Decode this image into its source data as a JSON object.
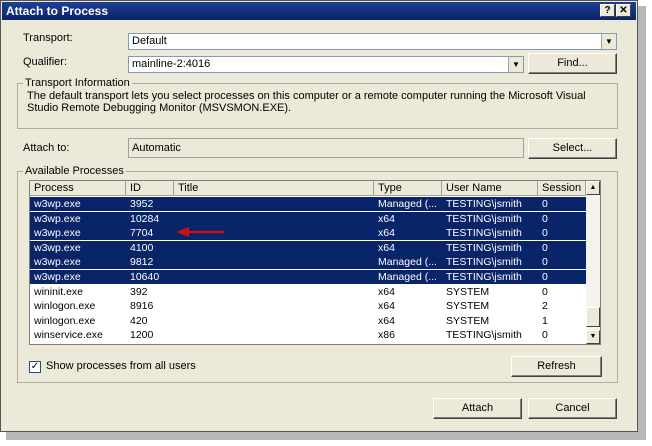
{
  "window": {
    "title": "Attach to Process",
    "help_glyph": "?",
    "close_glyph": "✕"
  },
  "transport": {
    "label": "Transport:",
    "value": "Default"
  },
  "qualifier": {
    "label": "Qualifier:",
    "value": "mainline-2:4016",
    "find_label": "Find..."
  },
  "transport_info": {
    "title": "Transport Information",
    "text": "The default transport lets you select processes on this computer or a remote computer running the Microsoft Visual Studio Remote Debugging Monitor (MSVSMON.EXE)."
  },
  "attach_to": {
    "label": "Attach to:",
    "value": "Automatic",
    "select_label": "Select..."
  },
  "processes": {
    "title": "Available Processes",
    "columns": [
      "Process",
      "ID",
      "Title",
      "Type",
      "User Name",
      "Session"
    ],
    "rows": [
      {
        "process": "w3wp.exe",
        "id": "3952",
        "title": "",
        "type": "Managed (...",
        "user": "TESTING\\jsmith",
        "session": "0",
        "selected": true
      },
      {
        "process": "w3wp.exe",
        "id": "10284",
        "title": "",
        "type": "x64",
        "user": "TESTING\\jsmith",
        "session": "0",
        "selected": true
      },
      {
        "process": "w3wp.exe",
        "id": "7704",
        "title": "",
        "type": "x64",
        "user": "TESTING\\jsmith",
        "session": "0",
        "selected": true
      },
      {
        "process": "w3wp.exe",
        "id": "4100",
        "title": "",
        "type": "x64",
        "user": "TESTING\\jsmith",
        "session": "0",
        "selected": true
      },
      {
        "process": "w3wp.exe",
        "id": "9812",
        "title": "",
        "type": "Managed (...",
        "user": "TESTING\\jsmith",
        "session": "0",
        "selected": true
      },
      {
        "process": "w3wp.exe",
        "id": "10640",
        "title": "",
        "type": "Managed (...",
        "user": "TESTING\\jsmith",
        "session": "0",
        "selected": true
      },
      {
        "process": "wininit.exe",
        "id": "392",
        "title": "",
        "type": "x64",
        "user": "SYSTEM",
        "session": "0",
        "selected": false
      },
      {
        "process": "winlogon.exe",
        "id": "8916",
        "title": "",
        "type": "x64",
        "user": "SYSTEM",
        "session": "2",
        "selected": false
      },
      {
        "process": "winlogon.exe",
        "id": "420",
        "title": "",
        "type": "x64",
        "user": "SYSTEM",
        "session": "1",
        "selected": false
      },
      {
        "process": "winservice.exe",
        "id": "1200",
        "title": "",
        "type": "x86",
        "user": "TESTING\\jsmith",
        "session": "0",
        "selected": false
      }
    ],
    "show_all_users_label": "Show processes from all users",
    "show_all_users_checked": true,
    "refresh_label": "Refresh"
  },
  "footer": {
    "attach_label": "Attach",
    "cancel_label": "Cancel"
  },
  "colors": {
    "selection": "#0a246a",
    "arrow": "#cc1111",
    "titlebar": "#0a246a"
  }
}
